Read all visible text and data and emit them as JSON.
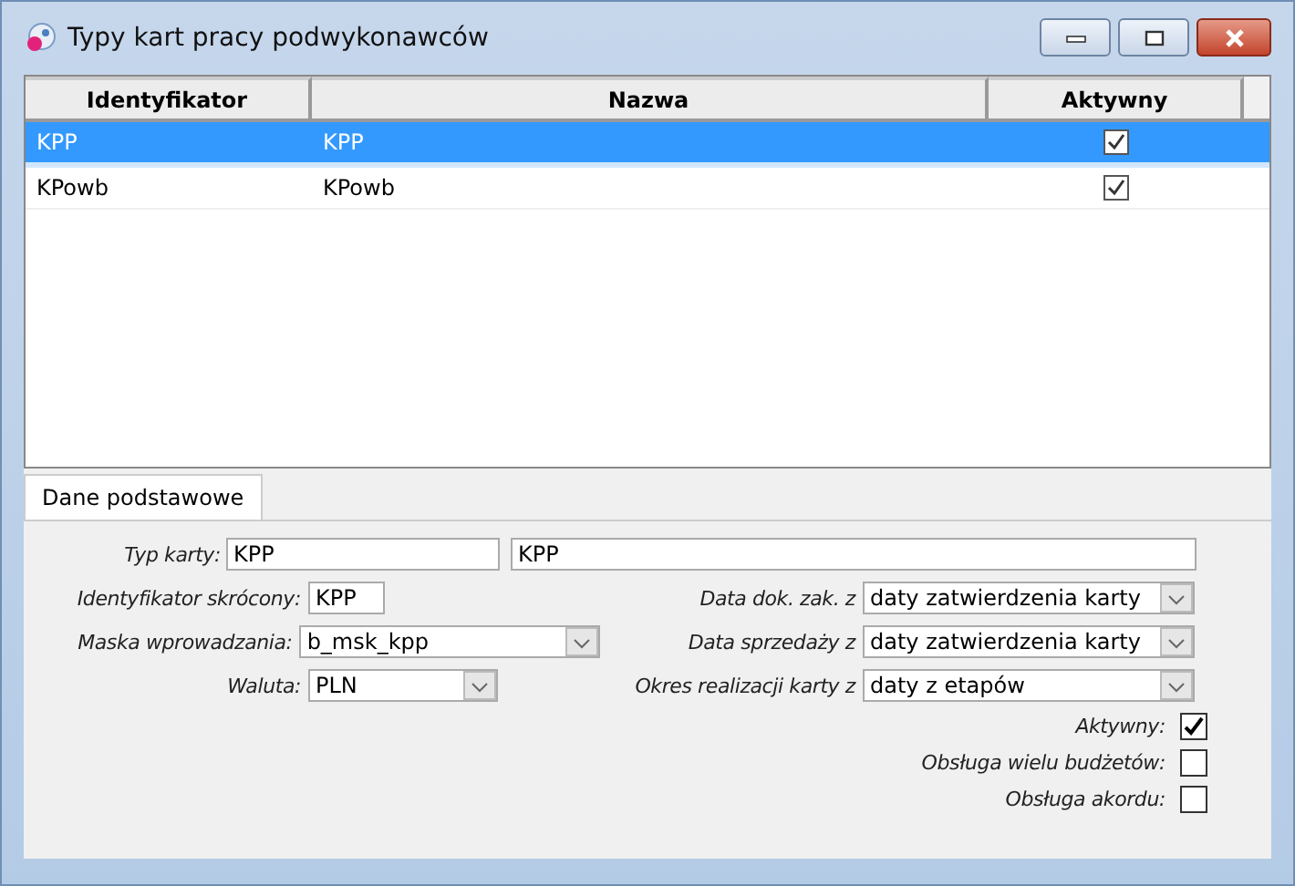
{
  "window": {
    "title": "Typy kart pracy podwykonawców"
  },
  "table": {
    "columns": [
      "Identyfikator",
      "Nazwa",
      "Aktywny"
    ],
    "rows": [
      {
        "id": "KPP",
        "name": "KPP",
        "active": true,
        "selected": true
      },
      {
        "id": "KPowb",
        "name": "KPowb",
        "active": true,
        "selected": false
      }
    ]
  },
  "tabs": [
    {
      "label": "Dane podstawowe",
      "selected": true
    }
  ],
  "form": {
    "card_type": {
      "label": "Typ karty:",
      "code": "KPP",
      "name": "KPP"
    },
    "left": [
      {
        "label": "Identyfikator skrócony:",
        "value": "KPP",
        "kind": "text"
      },
      {
        "label": "Maska wprowadzania:",
        "value": "b_msk_kpp",
        "kind": "select"
      },
      {
        "label": "Waluta:",
        "value": "PLN",
        "kind": "select"
      }
    ],
    "right": [
      {
        "label": "Data dok. zak.  z",
        "value": "daty zatwierdzenia karty"
      },
      {
        "label": "Data sprzedaży z",
        "value": "daty zatwierdzenia karty"
      },
      {
        "label": "Okres realizacji karty z",
        "value": "daty z etapów"
      }
    ],
    "checks": [
      {
        "label": "Aktywny:",
        "checked": true
      },
      {
        "label": "Obsługa wielu budżetów:",
        "checked": false
      },
      {
        "label": "Obsługa akordu:",
        "checked": false
      }
    ]
  }
}
